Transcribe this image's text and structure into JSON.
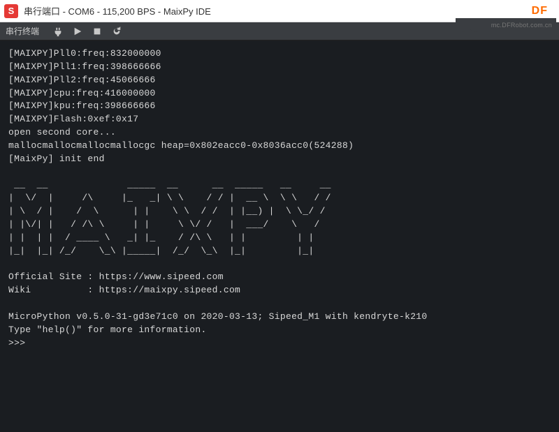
{
  "window": {
    "app_badge": "S",
    "title": "串行端口 - COM6 - 115,200 BPS - MaixPy IDE",
    "brand": "DF",
    "watermark": "mc.DFRobot.com.cn"
  },
  "toolbar": {
    "label": "串行终端"
  },
  "terminal_lines": [
    "[MAIXPY]Pll0:freq:832000000",
    "[MAIXPY]Pll1:freq:398666666",
    "[MAIXPY]Pll2:freq:45066666",
    "[MAIXPY]cpu:freq:416000000",
    "[MAIXPY]kpu:freq:398666666",
    "[MAIXPY]Flash:0xef:0x17",
    "open second core...",
    "mallocmallocmallocmallocgc heap=0x802eacc0-0x8036acc0(524288)",
    "[MaixPy] init end",
    "",
    " __  __              _____  __      __  _____   __     __",
    "|  \\/  |     /\\     |_   _| \\ \\    / / |  __ \\  \\ \\   / /",
    "| \\  / |    /  \\      | |    \\ \\  / /  | |__) |  \\ \\_/ /",
    "| |\\/| |   / /\\ \\     | |     \\ \\/ /   |  ___/    \\   /",
    "| |  | |  / ____ \\   _| |_    / /\\ \\   | |         | |",
    "|_|  |_| /_/    \\_\\ |_____|  /_/  \\_\\  |_|         |_|",
    "",
    "Official Site : https://www.sipeed.com",
    "Wiki          : https://maixpy.sipeed.com",
    "",
    "MicroPython v0.5.0-31-gd3e71c0 on 2020-03-13; Sipeed_M1 with kendryte-k210",
    "Type \"help()\" for more information.",
    ">>> "
  ]
}
